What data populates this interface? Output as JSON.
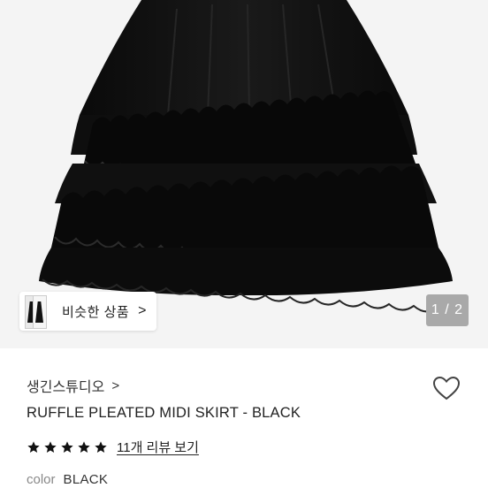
{
  "gallery": {
    "similar_button_label": "비슷한 상품",
    "similar_button_chevron": ">",
    "page_counter": "1 / 2",
    "current_image": 1,
    "total_images": 2
  },
  "product": {
    "brand": "생긴스튜디오",
    "brand_chevron": ">",
    "title": "RUFFLE PLEATED MIDI SKIRT - BLACK",
    "rating_stars": 5,
    "review_link": "11개 리뷰 보기",
    "color_key": "color",
    "color_value": "BLACK"
  },
  "colors": {
    "star": "#111111",
    "counter_bg": "#a9a9a9",
    "gallery_bg": "#f4f4f4"
  },
  "icons": [
    "heart-icon",
    "star-icon",
    "chevron-right-icon"
  ]
}
